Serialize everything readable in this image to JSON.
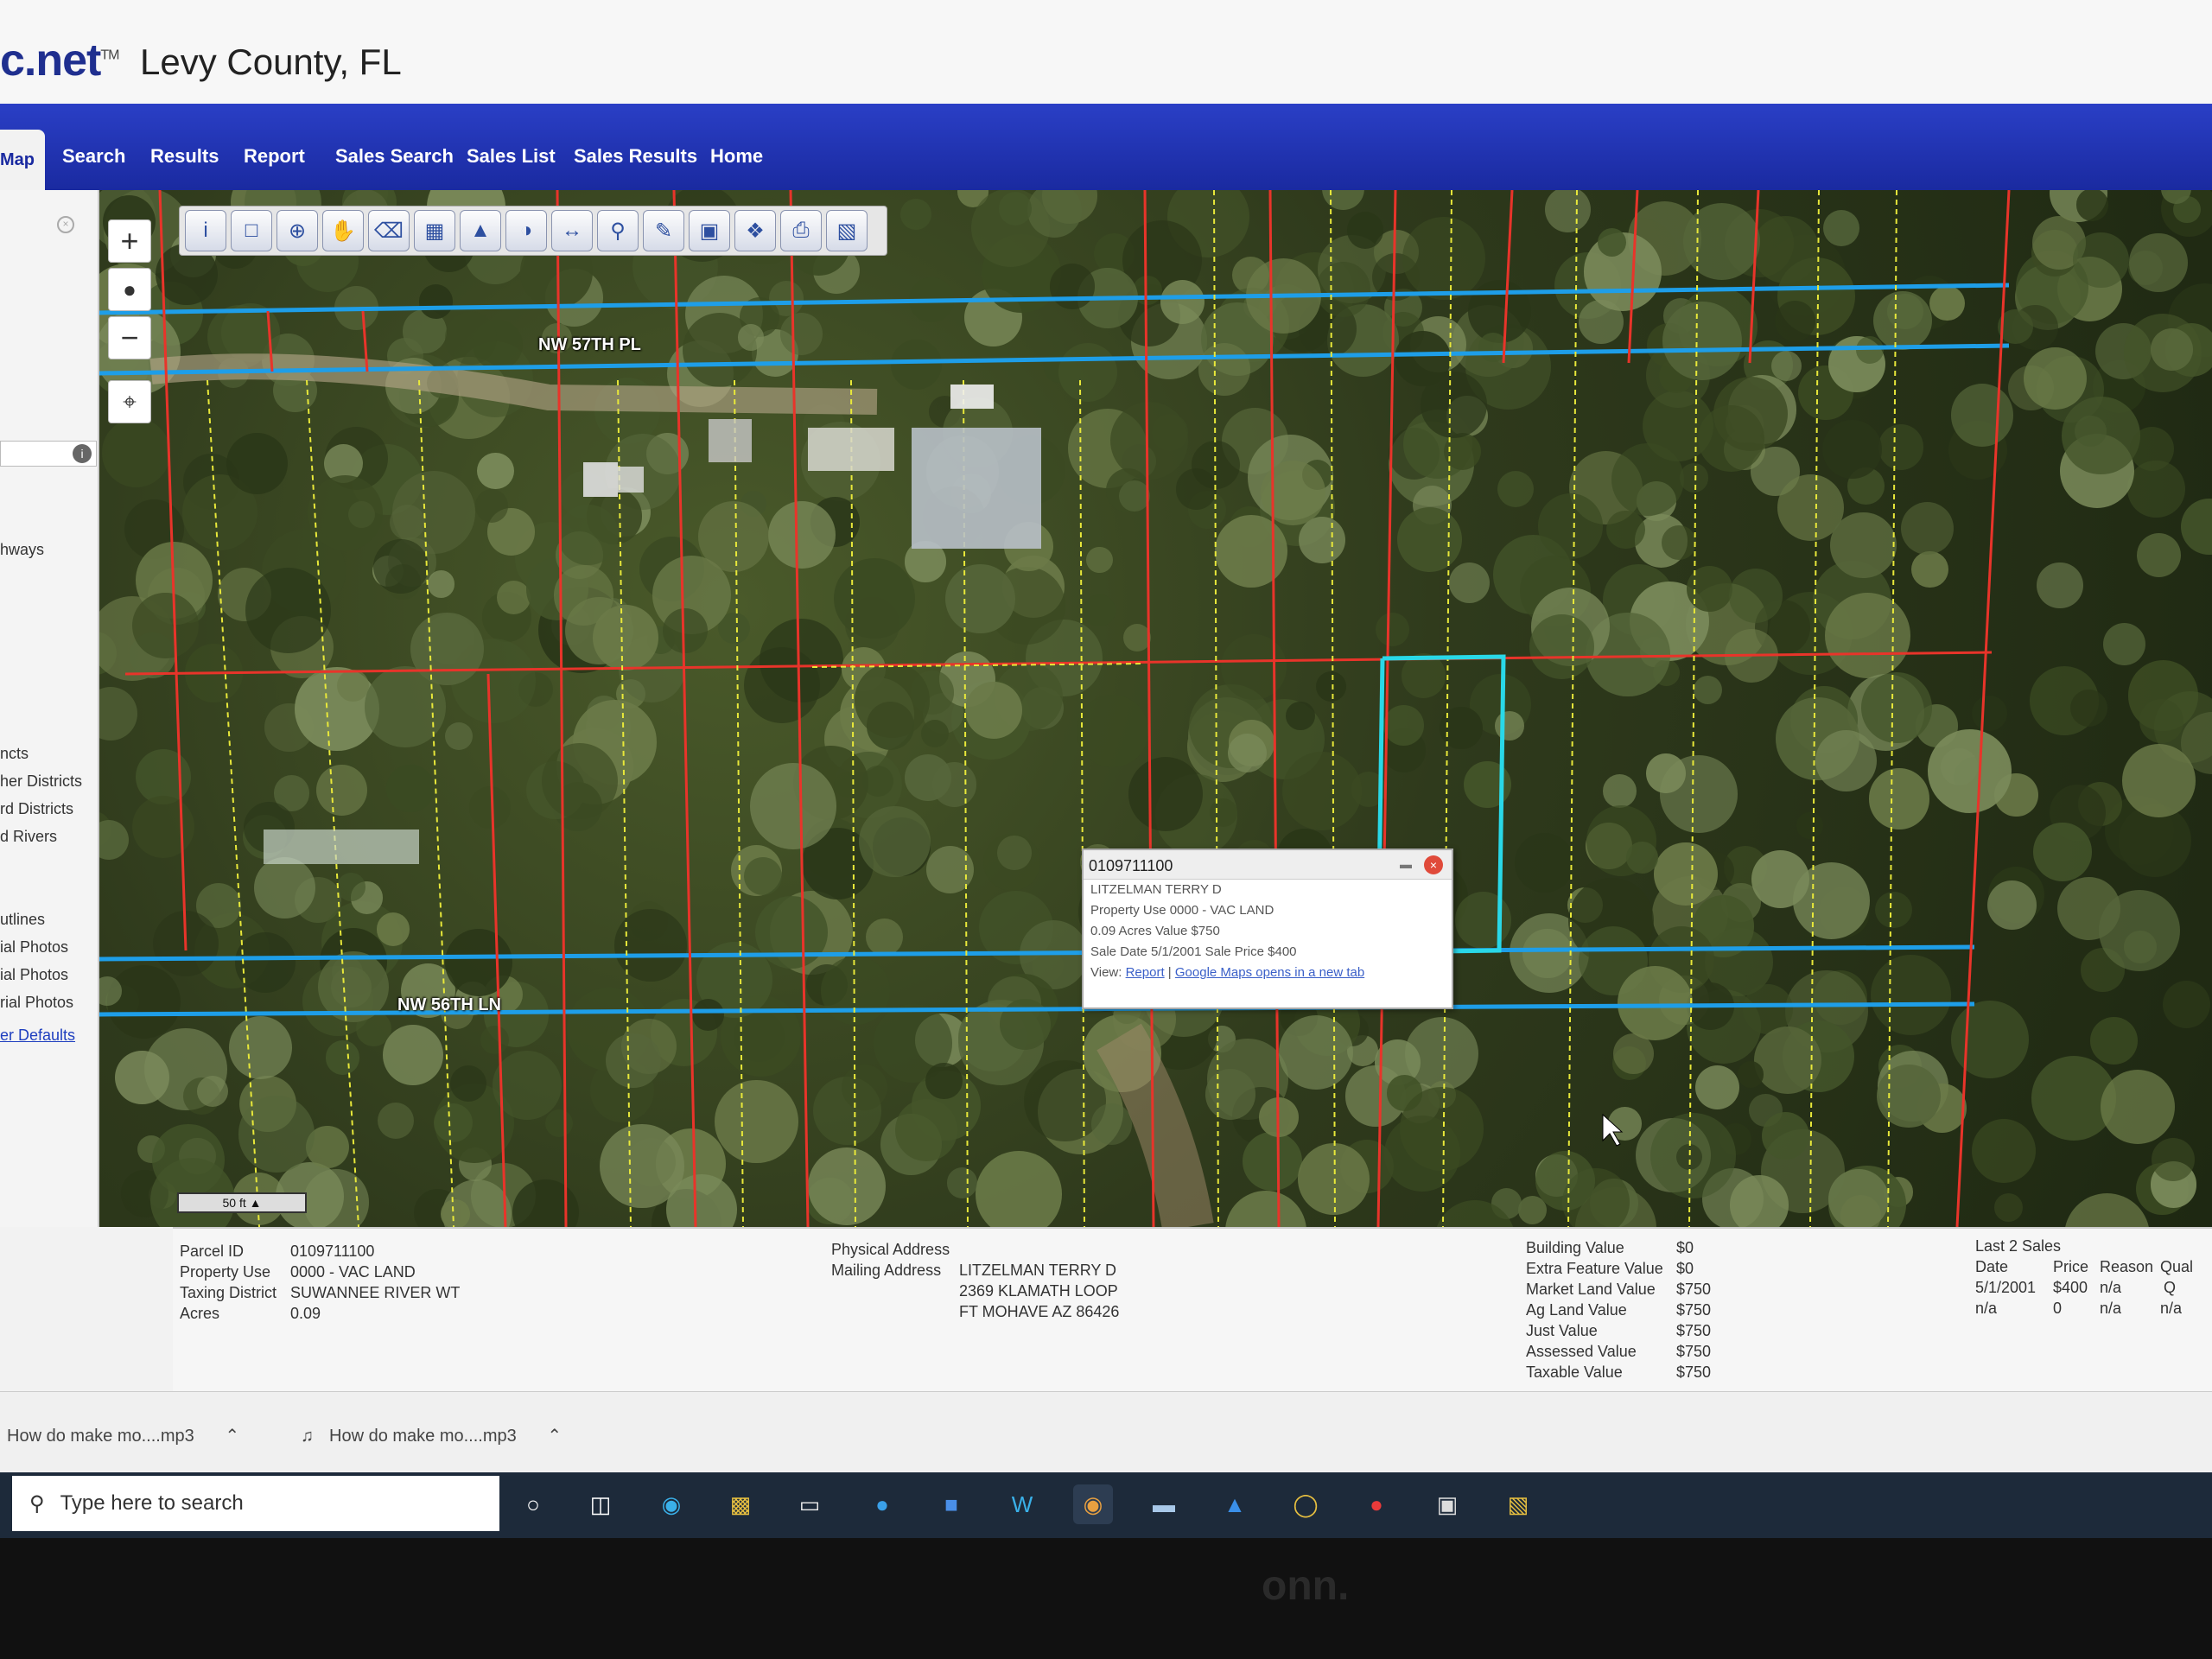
{
  "header": {
    "logo": "c.net",
    "logo_tm": "TM",
    "county": "Levy County, FL"
  },
  "nav": {
    "items": [
      "Map",
      "Search",
      "Results",
      "Report",
      "Sales Search",
      "Sales List",
      "Sales Results",
      "Home"
    ]
  },
  "sidebar": {
    "layers": [
      "hways",
      "ncts",
      "her Districts",
      "rd Districts",
      "d Rivers",
      "utlines",
      "ial Photos",
      "ial Photos",
      "rial Photos"
    ],
    "defaults_link": "er Defaults"
  },
  "map": {
    "road_labels": [
      "NW 57TH PL",
      "NW 56TH LN"
    ],
    "scale_label": "50 ft",
    "zoom_in": "+",
    "zoom_out": "−",
    "tool_icons": [
      "info-icon",
      "select-box-icon",
      "zoom-in-icon",
      "pan-hand-icon",
      "eraser-icon",
      "select-area-icon",
      "marker-icon",
      "layers-icon",
      "measure-icon",
      "search-icon",
      "pencil-icon",
      "photo-icon",
      "buffer-icon",
      "print-icon",
      "save-icon"
    ]
  },
  "popup": {
    "parcel": "0109711100",
    "owner": "LITZELMAN TERRY D",
    "use": "Property Use 0000 - VAC LAND",
    "acres": "0.09 Acres  Value $750",
    "sale": "Sale Date 5/1/2001 Sale Price $400",
    "view_prefix": "View:",
    "report_link": "Report",
    "sep": "|",
    "maps_link": "Google Maps opens in a new tab"
  },
  "info": {
    "left": [
      {
        "label": "Parcel ID",
        "value": "0109711100"
      },
      {
        "label": "Property Use",
        "value": "0000 - VAC LAND"
      },
      {
        "label": "Taxing District",
        "value": "SUWANNEE RIVER WT"
      },
      {
        "label": "Acres",
        "value": "0.09"
      }
    ],
    "physical_label": "Physical Address",
    "mailing_label": "Mailing Address",
    "mailing": [
      "LITZELMAN TERRY D",
      "2369 KLAMATH LOOP",
      "FT MOHAVE AZ 86426"
    ],
    "values": [
      {
        "label": "Building Value",
        "value": "$0"
      },
      {
        "label": "Extra Feature Value",
        "value": "$0"
      },
      {
        "label": "Market Land Value",
        "value": "$750"
      },
      {
        "label": "Ag Land Value",
        "value": "$750"
      },
      {
        "label": "Just Value",
        "value": "$750"
      },
      {
        "label": "Assessed Value",
        "value": "$750"
      },
      {
        "label": "Taxable Value",
        "value": "$750"
      }
    ],
    "sales_title": "Last 2 Sales",
    "sales_headers": [
      "Date",
      "Price",
      "Reason",
      "Qual"
    ],
    "sales_rows": [
      [
        "5/1/2001",
        "$400",
        "n/a",
        "Q"
      ],
      [
        "n/a",
        "0",
        "n/a",
        "n/a"
      ]
    ]
  },
  "downloads": {
    "items": [
      "How do make mo....mp3",
      "How do make mo....mp3"
    ]
  },
  "taskbar": {
    "search_placeholder": "Type here to search"
  },
  "monitor": {
    "brand": "onn."
  },
  "colors": {
    "nav": "#1a2aa0",
    "parcel_line": "#e8342a",
    "road_line": "#1e9ee8",
    "lot_line": "#e8e83a",
    "selected_parcel": "#29d8e8"
  }
}
